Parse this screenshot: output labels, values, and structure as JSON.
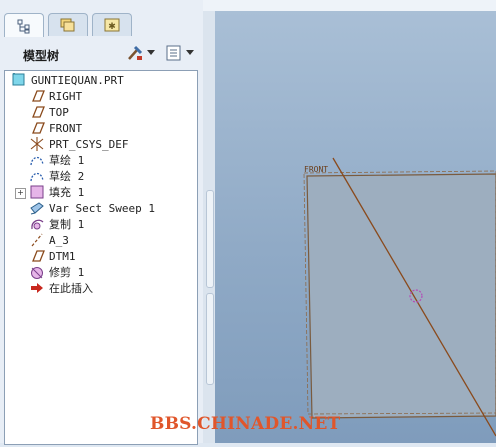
{
  "tabs": [
    {
      "name": "model-tree-tab",
      "icon": "tree-icon"
    },
    {
      "name": "folder-browser-tab",
      "icon": "folders-icon"
    },
    {
      "name": "favorites-tab",
      "icon": "favorites-icon"
    }
  ],
  "panel": {
    "title": "模型树",
    "tools": [
      {
        "icon": "settings-tools-icon"
      },
      {
        "icon": "show-list-icon"
      }
    ]
  },
  "tree": {
    "root": "GUNTIEQUAN.PRT",
    "items": [
      {
        "label": "RIGHT",
        "icon": "datum-plane-icon"
      },
      {
        "label": "TOP",
        "icon": "datum-plane-icon"
      },
      {
        "label": "FRONT",
        "icon": "datum-plane-icon"
      },
      {
        "label": "PRT_CSYS_DEF",
        "icon": "csys-icon"
      },
      {
        "label": "草绘 1",
        "icon": "sketch-icon"
      },
      {
        "label": "草绘 2",
        "icon": "sketch-icon"
      },
      {
        "label": "填充 1",
        "icon": "fill-icon",
        "expandable": true
      },
      {
        "label": "Var Sect Sweep 1",
        "icon": "var-sweep-icon"
      },
      {
        "label": "复制 1",
        "icon": "copy-icon"
      },
      {
        "label": "A_3",
        "icon": "axis-icon"
      },
      {
        "label": "DTM1",
        "icon": "datum-plane-icon"
      },
      {
        "label": "修剪 1",
        "icon": "trim-icon"
      },
      {
        "label": "在此插入",
        "icon": "insert-here-icon"
      }
    ]
  },
  "viewport": {
    "plane_label": "FRONT"
  },
  "watermark": "BBS.CHINADE.NET",
  "colors": {
    "viewport_bg": "#92abc8",
    "plane_fill": "#9daebf",
    "plane_edge": "#7a5b3e",
    "axis_line": "#8a4a1c",
    "watermark": "#e0562b"
  }
}
